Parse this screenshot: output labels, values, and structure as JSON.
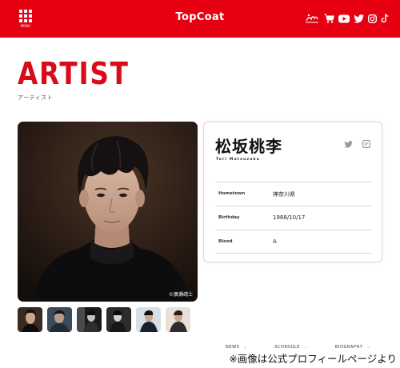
{
  "header": {
    "menu_label": "MENU",
    "brand": "TopCoat",
    "icons": [
      "fanclub-logo-icon",
      "cart-icon",
      "youtube-icon",
      "twitter-icon",
      "instagram-icon",
      "tiktok-icon"
    ],
    "color": "#e60012"
  },
  "page": {
    "title": "ARTIST",
    "subtitle": "アーティスト",
    "accent_color": "#d80c18"
  },
  "photo": {
    "credit": "©廣瀬靖士",
    "thumbnail_count": 6
  },
  "artist": {
    "name": "松坂桃李",
    "romanized": "Tori Matsuzaka",
    "social_icons": [
      "twitter-icon",
      "blog-icon"
    ],
    "info": [
      {
        "label": "Hometown",
        "value": "神奈川県"
      },
      {
        "label": "Birthday",
        "value": "1988/10/17"
      },
      {
        "label": "Blood",
        "value": "A"
      }
    ]
  },
  "nav": {
    "items": [
      "NEWS",
      "SCHEDULE",
      "BIOGRAPHY"
    ]
  },
  "caption": "※画像は公式プロフィールページより"
}
